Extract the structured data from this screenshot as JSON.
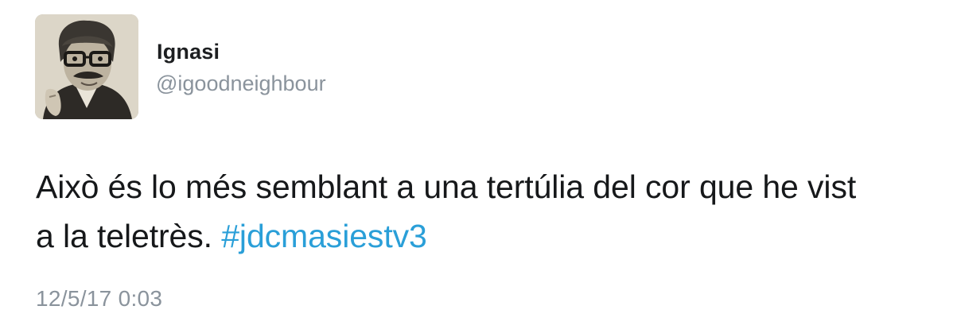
{
  "tweet": {
    "author": {
      "display_name": "Ignasi",
      "handle": "@igoodneighbour"
    },
    "text_line1": "Això és lo més semblant a una tertúlia del cor que he vist",
    "text_line2": "a la teletrès. ",
    "hashtag": "#jdcmasiestv3",
    "timestamp": "12/5/17 0:03"
  },
  "colors": {
    "hashtag": "#2a9fd8",
    "muted_text": "#8a939c",
    "body_text": "#16181a"
  }
}
